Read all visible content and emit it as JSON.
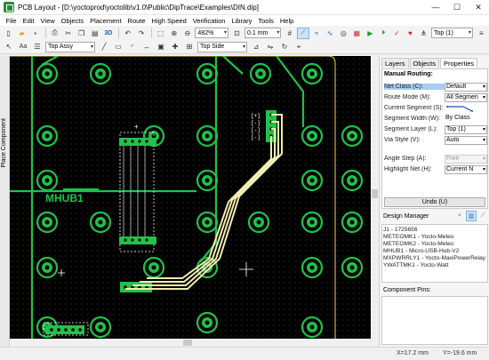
{
  "window": {
    "title": "PCB Layout - [D:\\yoctoprod\\yoctolib\\v1.0\\Public\\DipTrace\\Examples\\DIN.dip]",
    "minimize": "—",
    "maximize": "☐",
    "close": "✕"
  },
  "menu": [
    "File",
    "Edit",
    "View",
    "Objects",
    "Placement",
    "Route",
    "High Speed",
    "Verification",
    "Library",
    "Tools",
    "Help"
  ],
  "toolbar1": {
    "zoom": "482%",
    "width": "0.1 mm",
    "layer": "Top (1)",
    "label_3d": "3D"
  },
  "toolbar2": {
    "assembly": "Top Assy",
    "side": "Top Side"
  },
  "side_tab": "Place Component",
  "canvas": {
    "label": "MHUB1",
    "pin_labels": [
      "[+]",
      "[-]",
      "[-]",
      "[-]"
    ]
  },
  "panel": {
    "tabs": [
      "Layers",
      "Objects",
      "Properties"
    ],
    "active_tab": "Properties",
    "heading": "Manual Routing:",
    "rows": [
      {
        "label": "Net Class (C):",
        "value": "Default",
        "kind": "combo",
        "highlight": true
      },
      {
        "label": "Route Mode (M):",
        "value": "All Segmen",
        "kind": "combo"
      },
      {
        "label": "Current Segment (S):",
        "value": "",
        "kind": "plain"
      },
      {
        "label": "Segment Width (W):",
        "value": "By Class",
        "kind": "plain"
      },
      {
        "label": "Segment Layer (L):",
        "value": "Top (1)",
        "kind": "combo"
      },
      {
        "label": "Via Style (V):",
        "value": "Auto",
        "kind": "combo"
      },
      {
        "label": "Angle Step (A):",
        "value": "Free",
        "kind": "disabled"
      },
      {
        "label": "Highlight Net (H):",
        "value": "Current N",
        "kind": "combo"
      }
    ],
    "undo_button": "Undo (U)",
    "design_manager": "Design Manager",
    "components": [
      "J1 - 1725656",
      "METEOMK1 - Yocto-Meteo",
      "METEOMK2 - Yocto-Meteo",
      "MHUB1 - Micro-USB-Hub-V2",
      "MXPWRRLY1 - Yocto-MaxiPowerRelay",
      "YWATTMK1 - Yocto-Watt"
    ],
    "component_pins": "Component Pins:"
  },
  "status": {
    "x": "X=17.2 mm",
    "y": "Y=-19.6 mm"
  },
  "colors": {
    "board": "#000000",
    "copper": "#22c14a",
    "route": "#f3ecb0",
    "highlight": "#a8cdef"
  }
}
